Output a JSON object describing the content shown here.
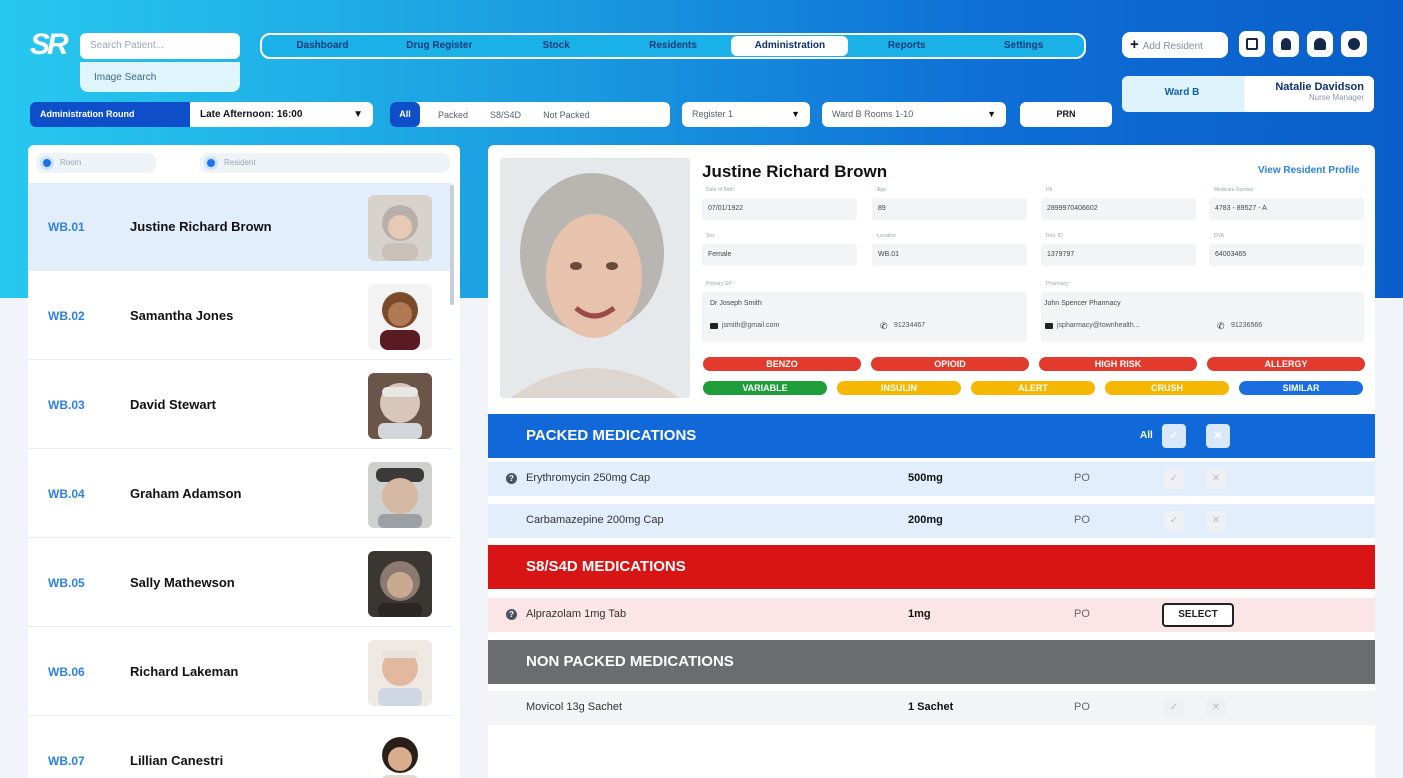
{
  "header": {
    "search_placeholder": "Search Patient...",
    "image_search": "Image Search",
    "nav_tabs": [
      "Dashboard",
      "Drug Register",
      "Stock",
      "Residents",
      "Administration",
      "Reports",
      "Settings"
    ],
    "active_tab": "Administration",
    "add_resident": "Add Resident",
    "ward": "Ward B",
    "user_name": "Natalie Davidson",
    "user_role": "Nurse Manager"
  },
  "filters": {
    "round_label": "Administration Round",
    "round_value": "Late Afternoon: 16:00",
    "pack_options": [
      "All",
      "Packed",
      "S8/S4D",
      "Not Packed"
    ],
    "register": "Register 1",
    "rooms": "Ward B Rooms 1-10",
    "prn": "PRN"
  },
  "left": {
    "search_room": "Room",
    "search_resident": "Resident",
    "residents": [
      {
        "room": "WB.01",
        "name": "Justine Richard Brown"
      },
      {
        "room": "WB.02",
        "name": "Samantha Jones"
      },
      {
        "room": "WB.03",
        "name": "David Stewart"
      },
      {
        "room": "WB.04",
        "name": "Graham Adamson"
      },
      {
        "room": "WB.05",
        "name": "Sally Mathewson"
      },
      {
        "room": "WB.06",
        "name": "Richard Lakeman"
      },
      {
        "room": "WB.07",
        "name": "Lillian Canestri"
      }
    ]
  },
  "profile": {
    "name": "Justine Richard Brown",
    "view_profile": "View Resident Profile",
    "fields": [
      {
        "label": "Date of Birth",
        "value": "07/01/1922"
      },
      {
        "label": "Age",
        "value": "89"
      },
      {
        "label": "IHI",
        "value": "2899970406602"
      },
      {
        "label": "Medicare Number",
        "value": "4783 - 89527 - A"
      },
      {
        "label": "Sex",
        "value": "Female"
      },
      {
        "label": "Location",
        "value": "WB.01"
      },
      {
        "label": "Res. ID",
        "value": "1379797"
      },
      {
        "label": "DVA",
        "value": "64003465"
      }
    ],
    "gp_label": "Primary GP",
    "gp_name": "Dr Joseph Smith",
    "gp_email": "jsmith@gmail.com",
    "gp_phone": "91234467",
    "pharmacy_label": "Pharmacy",
    "pharmacy_name": "John Spencer Pharmacy",
    "pharmacy_email": "jspharmacy@townhealth...",
    "pharmacy_phone": "91236566",
    "tags": [
      {
        "label": "BENZO",
        "color": "#e23b2e"
      },
      {
        "label": "OPIOID",
        "color": "#e23b2e"
      },
      {
        "label": "HIGH RISK",
        "color": "#e23b2e"
      },
      {
        "label": "ALLERGY",
        "color": "#e23b2e"
      },
      {
        "label": "VARIABLE",
        "color": "#1f9d3a"
      },
      {
        "label": "INSULIN",
        "color": "#f5b700"
      },
      {
        "label": "ALERT",
        "color": "#f5b700"
      },
      {
        "label": "CRUSH",
        "color": "#f5b700"
      },
      {
        "label": "SIMILAR",
        "color": "#1a6ee0"
      }
    ]
  },
  "packed": {
    "title": "PACKED MEDICATIONS",
    "all_label": "All",
    "color": "#1168d8",
    "meds": [
      {
        "name": "Erythromycin 250mg Cap",
        "dose": "500mg",
        "route": "PO"
      },
      {
        "name": "Carbamazepine 200mg Cap",
        "dose": "200mg",
        "route": "PO"
      }
    ]
  },
  "s8": {
    "title": "S8/S4D MEDICATIONS",
    "color": "#d81414",
    "meds": [
      {
        "name": "Alprazolam 1mg Tab",
        "dose": "1mg",
        "route": "PO",
        "action": "SELECT"
      }
    ]
  },
  "nonpacked": {
    "title": "NON PACKED MEDICATIONS",
    "color": "#6a6c6e",
    "meds": [
      {
        "name": "Movicol 13g Sachet",
        "dose": "1 Sachet",
        "route": "PO"
      }
    ]
  }
}
